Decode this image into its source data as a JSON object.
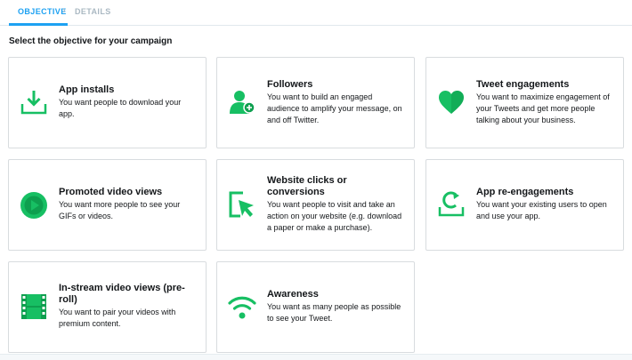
{
  "tabs": {
    "objective": "OBJECTIVE",
    "details": "DETAILS"
  },
  "page": {
    "title": "Select the objective for your campaign"
  },
  "colors": {
    "accent": "#1da1f2",
    "icon_green": "#17bf63",
    "icon_dark_green": "#0e9f4f"
  },
  "objectives": [
    {
      "title": "App installs",
      "desc": "You want people to download your app.",
      "icon": "download-icon"
    },
    {
      "title": "Followers",
      "desc": "You want to build an engaged audience to amplify your message, on and off Twitter.",
      "icon": "user-follow-icon"
    },
    {
      "title": "Tweet engagements",
      "desc": "You want to maximize engagement of your Tweets and get more people talking about your business.",
      "icon": "heart-icon"
    },
    {
      "title": "Promoted video views",
      "desc": "You want more people to see your GIFs or videos.",
      "icon": "play-icon"
    },
    {
      "title": "Website clicks or conversions",
      "desc": "You want people to visit and take an action on your website (e.g. download a paper or make a purchase).",
      "icon": "cursor-click-icon"
    },
    {
      "title": "App re-engagements",
      "desc": "You want your existing users to open and use your app.",
      "icon": "reengage-icon"
    },
    {
      "title": "In-stream video views (pre-roll)",
      "desc": "You want to pair your videos with premium content.",
      "icon": "film-icon"
    },
    {
      "title": "Awareness",
      "desc": "You want as many people as possible to see your Tweet.",
      "icon": "signal-icon"
    }
  ]
}
